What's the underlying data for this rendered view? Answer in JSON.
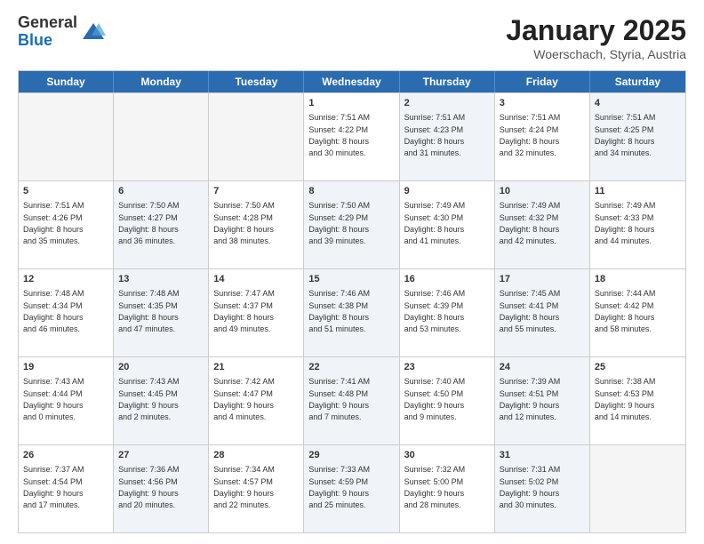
{
  "logo": {
    "general": "General",
    "blue": "Blue"
  },
  "title": "January 2025",
  "subtitle": "Woerschach, Styria, Austria",
  "header_days": [
    "Sunday",
    "Monday",
    "Tuesday",
    "Wednesday",
    "Thursday",
    "Friday",
    "Saturday"
  ],
  "rows": [
    [
      {
        "day": "",
        "info": "",
        "shaded": false,
        "empty": true
      },
      {
        "day": "",
        "info": "",
        "shaded": false,
        "empty": true
      },
      {
        "day": "",
        "info": "",
        "shaded": false,
        "empty": true
      },
      {
        "day": "1",
        "info": "Sunrise: 7:51 AM\nSunset: 4:22 PM\nDaylight: 8 hours\nand 30 minutes.",
        "shaded": false,
        "empty": false
      },
      {
        "day": "2",
        "info": "Sunrise: 7:51 AM\nSunset: 4:23 PM\nDaylight: 8 hours\nand 31 minutes.",
        "shaded": true,
        "empty": false
      },
      {
        "day": "3",
        "info": "Sunrise: 7:51 AM\nSunset: 4:24 PM\nDaylight: 8 hours\nand 32 minutes.",
        "shaded": false,
        "empty": false
      },
      {
        "day": "4",
        "info": "Sunrise: 7:51 AM\nSunset: 4:25 PM\nDaylight: 8 hours\nand 34 minutes.",
        "shaded": true,
        "empty": false
      }
    ],
    [
      {
        "day": "5",
        "info": "Sunrise: 7:51 AM\nSunset: 4:26 PM\nDaylight: 8 hours\nand 35 minutes.",
        "shaded": false,
        "empty": false
      },
      {
        "day": "6",
        "info": "Sunrise: 7:50 AM\nSunset: 4:27 PM\nDaylight: 8 hours\nand 36 minutes.",
        "shaded": true,
        "empty": false
      },
      {
        "day": "7",
        "info": "Sunrise: 7:50 AM\nSunset: 4:28 PM\nDaylight: 8 hours\nand 38 minutes.",
        "shaded": false,
        "empty": false
      },
      {
        "day": "8",
        "info": "Sunrise: 7:50 AM\nSunset: 4:29 PM\nDaylight: 8 hours\nand 39 minutes.",
        "shaded": true,
        "empty": false
      },
      {
        "day": "9",
        "info": "Sunrise: 7:49 AM\nSunset: 4:30 PM\nDaylight: 8 hours\nand 41 minutes.",
        "shaded": false,
        "empty": false
      },
      {
        "day": "10",
        "info": "Sunrise: 7:49 AM\nSunset: 4:32 PM\nDaylight: 8 hours\nand 42 minutes.",
        "shaded": true,
        "empty": false
      },
      {
        "day": "11",
        "info": "Sunrise: 7:49 AM\nSunset: 4:33 PM\nDaylight: 8 hours\nand 44 minutes.",
        "shaded": false,
        "empty": false
      }
    ],
    [
      {
        "day": "12",
        "info": "Sunrise: 7:48 AM\nSunset: 4:34 PM\nDaylight: 8 hours\nand 46 minutes.",
        "shaded": false,
        "empty": false
      },
      {
        "day": "13",
        "info": "Sunrise: 7:48 AM\nSunset: 4:35 PM\nDaylight: 8 hours\nand 47 minutes.",
        "shaded": true,
        "empty": false
      },
      {
        "day": "14",
        "info": "Sunrise: 7:47 AM\nSunset: 4:37 PM\nDaylight: 8 hours\nand 49 minutes.",
        "shaded": false,
        "empty": false
      },
      {
        "day": "15",
        "info": "Sunrise: 7:46 AM\nSunset: 4:38 PM\nDaylight: 8 hours\nand 51 minutes.",
        "shaded": true,
        "empty": false
      },
      {
        "day": "16",
        "info": "Sunrise: 7:46 AM\nSunset: 4:39 PM\nDaylight: 8 hours\nand 53 minutes.",
        "shaded": false,
        "empty": false
      },
      {
        "day": "17",
        "info": "Sunrise: 7:45 AM\nSunset: 4:41 PM\nDaylight: 8 hours\nand 55 minutes.",
        "shaded": true,
        "empty": false
      },
      {
        "day": "18",
        "info": "Sunrise: 7:44 AM\nSunset: 4:42 PM\nDaylight: 8 hours\nand 58 minutes.",
        "shaded": false,
        "empty": false
      }
    ],
    [
      {
        "day": "19",
        "info": "Sunrise: 7:43 AM\nSunset: 4:44 PM\nDaylight: 9 hours\nand 0 minutes.",
        "shaded": false,
        "empty": false
      },
      {
        "day": "20",
        "info": "Sunrise: 7:43 AM\nSunset: 4:45 PM\nDaylight: 9 hours\nand 2 minutes.",
        "shaded": true,
        "empty": false
      },
      {
        "day": "21",
        "info": "Sunrise: 7:42 AM\nSunset: 4:47 PM\nDaylight: 9 hours\nand 4 minutes.",
        "shaded": false,
        "empty": false
      },
      {
        "day": "22",
        "info": "Sunrise: 7:41 AM\nSunset: 4:48 PM\nDaylight: 9 hours\nand 7 minutes.",
        "shaded": true,
        "empty": false
      },
      {
        "day": "23",
        "info": "Sunrise: 7:40 AM\nSunset: 4:50 PM\nDaylight: 9 hours\nand 9 minutes.",
        "shaded": false,
        "empty": false
      },
      {
        "day": "24",
        "info": "Sunrise: 7:39 AM\nSunset: 4:51 PM\nDaylight: 9 hours\nand 12 minutes.",
        "shaded": true,
        "empty": false
      },
      {
        "day": "25",
        "info": "Sunrise: 7:38 AM\nSunset: 4:53 PM\nDaylight: 9 hours\nand 14 minutes.",
        "shaded": false,
        "empty": false
      }
    ],
    [
      {
        "day": "26",
        "info": "Sunrise: 7:37 AM\nSunset: 4:54 PM\nDaylight: 9 hours\nand 17 minutes.",
        "shaded": false,
        "empty": false
      },
      {
        "day": "27",
        "info": "Sunrise: 7:36 AM\nSunset: 4:56 PM\nDaylight: 9 hours\nand 20 minutes.",
        "shaded": true,
        "empty": false
      },
      {
        "day": "28",
        "info": "Sunrise: 7:34 AM\nSunset: 4:57 PM\nDaylight: 9 hours\nand 22 minutes.",
        "shaded": false,
        "empty": false
      },
      {
        "day": "29",
        "info": "Sunrise: 7:33 AM\nSunset: 4:59 PM\nDaylight: 9 hours\nand 25 minutes.",
        "shaded": true,
        "empty": false
      },
      {
        "day": "30",
        "info": "Sunrise: 7:32 AM\nSunset: 5:00 PM\nDaylight: 9 hours\nand 28 minutes.",
        "shaded": false,
        "empty": false
      },
      {
        "day": "31",
        "info": "Sunrise: 7:31 AM\nSunset: 5:02 PM\nDaylight: 9 hours\nand 30 minutes.",
        "shaded": true,
        "empty": false
      },
      {
        "day": "",
        "info": "",
        "shaded": false,
        "empty": true
      }
    ]
  ]
}
